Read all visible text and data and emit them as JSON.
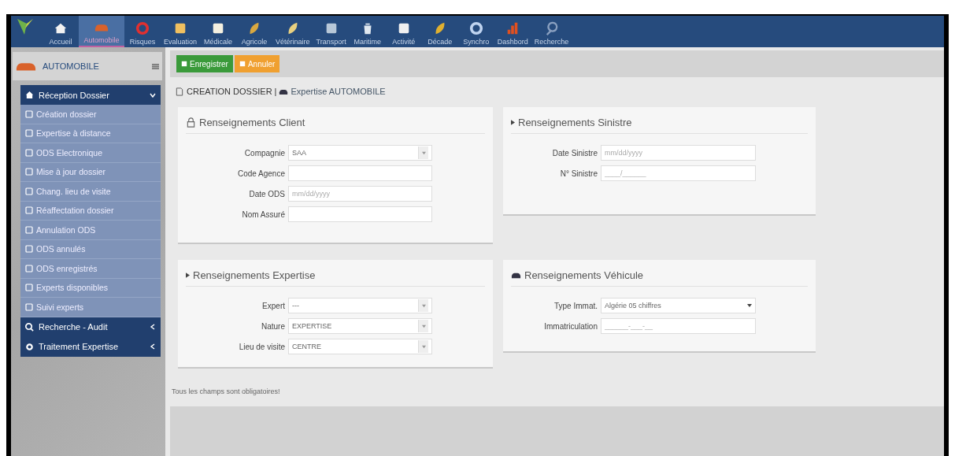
{
  "nav": [
    {
      "label": "Accueil",
      "selected": false
    },
    {
      "label": "Automobile",
      "selected": true
    },
    {
      "label": "Risques",
      "selected": false
    },
    {
      "label": "Evaluation",
      "selected": false
    },
    {
      "label": "Médicale",
      "selected": false
    },
    {
      "label": "Agricole",
      "selected": false
    },
    {
      "label": "Vétérinaire",
      "selected": false
    },
    {
      "label": "Transport",
      "selected": false
    },
    {
      "label": "Maritime",
      "selected": false
    },
    {
      "label": "Activité",
      "selected": false
    },
    {
      "label": "Décade",
      "selected": false
    },
    {
      "label": "Synchro",
      "selected": false
    },
    {
      "label": "Dashbord",
      "selected": false
    },
    {
      "label": "Recherche",
      "selected": false
    }
  ],
  "sidebar": {
    "title": "AUTOMOBILE",
    "items": [
      {
        "label": "Réception Dossier",
        "expanded": true,
        "children": [
          {
            "label": "Création dossier"
          },
          {
            "label": "Expertise à distance"
          },
          {
            "label": "ODS Electronique"
          },
          {
            "label": "Mise à jour dossier"
          },
          {
            "label": "Chang. lieu de visite"
          },
          {
            "label": "Réaffectation dossier"
          },
          {
            "label": "Annulation ODS"
          },
          {
            "label": "ODS annulés"
          },
          {
            "label": "ODS enregistrés"
          },
          {
            "label": "Experts disponibles"
          },
          {
            "label": "Suivi experts"
          }
        ]
      },
      {
        "label": "Recherche - Audit",
        "expanded": false
      },
      {
        "label": "Traitement Expertise",
        "expanded": false
      }
    ]
  },
  "toolbar": [
    {
      "label": "Enregistrer",
      "kind": "save"
    },
    {
      "label": "Annuler",
      "kind": "cancel"
    }
  ],
  "breadcrumb": {
    "section": "CREATION DOSSIER",
    "separator": "|",
    "page": "Expertise AUTOMOBILE"
  },
  "panels": [
    {
      "title": "Renseignements Client",
      "fields": [
        {
          "label": "Compagnie",
          "kind": "select",
          "value": "SAA"
        },
        {
          "label": "Code Agence",
          "kind": "input"
        },
        {
          "label": "Date ODS",
          "kind": "input",
          "placeholder": "mm/dd/yyyy"
        },
        {
          "label": "Nom Assuré",
          "kind": "input"
        }
      ]
    },
    {
      "title": "Renseignements Sinistre",
      "fields": [
        {
          "label": "Date Sinistre",
          "kind": "input",
          "placeholder": "mm/dd/yyyy"
        },
        {
          "label": "N° Sinistre",
          "kind": "input",
          "placeholder": "____/______"
        }
      ]
    },
    {
      "title": "Renseignements Expertise",
      "fields": [
        {
          "label": "Expert",
          "kind": "select",
          "value": "---"
        },
        {
          "label": "Nature",
          "kind": "select",
          "value": "EXPERTISE"
        },
        {
          "label": "Lieu de visite",
          "kind": "select",
          "value": "CENTRE"
        }
      ]
    },
    {
      "title": "Renseignements Véhicule",
      "fields": [
        {
          "label": "Type Immat.",
          "kind": "dropdown",
          "value": "Algérie 05 chiffres"
        },
        {
          "label": "Immatriculation",
          "kind": "input",
          "placeholder": "______-___-__"
        }
      ]
    }
  ],
  "note": "Tous les champs sont obligatoires!"
}
